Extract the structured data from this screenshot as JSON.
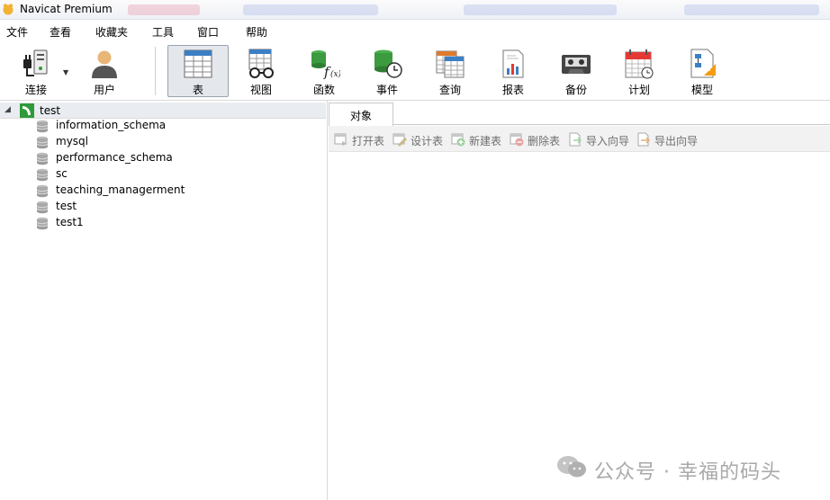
{
  "window": {
    "title": "Navicat Premium"
  },
  "menu": [
    "文件",
    "查看",
    "收藏夹",
    "工具",
    "窗口",
    "帮助"
  ],
  "toolbar": {
    "connect": "连接",
    "user": "用户",
    "table": "表",
    "view": "视图",
    "function": "函数",
    "event": "事件",
    "query": "查询",
    "report": "报表",
    "backup": "备份",
    "schedule": "计划",
    "model": "模型"
  },
  "tree": {
    "connection": "test",
    "databases": [
      "information_schema",
      "mysql",
      "performance_schema",
      "sc",
      "teaching_managerment",
      "test",
      "test1"
    ]
  },
  "objects": {
    "tab": "对象",
    "actions": [
      "打开表",
      "设计表",
      "新建表",
      "删除表",
      "导入向导",
      "导出向导"
    ]
  },
  "watermark": "公众号 · 幸福的码头",
  "colors": {
    "accent": "#2e9a3a",
    "selected_bg": "#e4e7ec",
    "toolbar_bg": "#f2f2f2"
  }
}
